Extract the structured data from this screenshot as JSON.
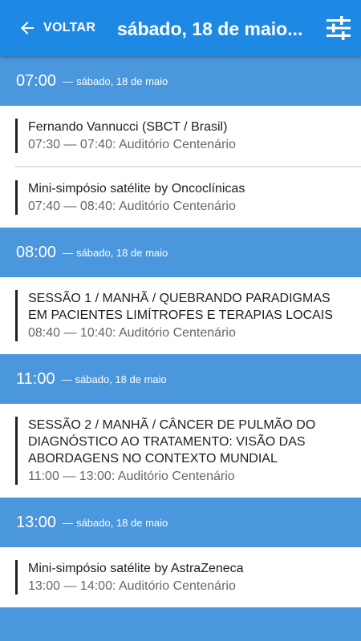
{
  "header": {
    "back_label": "VOLTAR",
    "title": "sábado, 18 de maio..."
  },
  "groups": [
    {
      "time": "07:00",
      "dash": "—",
      "date": "sábado, 18 de maio",
      "sessions": [
        {
          "title": "Fernando Vannucci (SBCT / Brasil)",
          "sub": "07:30 — 07:40: Auditório Centenário"
        },
        {
          "title": "Mini-simpósio satélite by Oncoclínicas",
          "sub": "07:40 — 08:40: Auditório Centenário"
        }
      ]
    },
    {
      "time": "08:00",
      "dash": "—",
      "date": "sábado, 18 de maio",
      "sessions": [
        {
          "title": "SESSÃO 1 / MANHÃ / QUEBRANDO PARADIGMAS EM PACIENTES LIMÍTROFES E TERAPIAS LOCAIS",
          "sub": "08:40 — 10:40: Auditório Centenário"
        }
      ]
    },
    {
      "time": "11:00",
      "dash": "—",
      "date": "sábado, 18 de maio",
      "sessions": [
        {
          "title": "SESSÃO 2 / MANHÃ / CÂNCER DE PULMÃO DO DIAGNÓSTICO AO TRATAMENTO: VISÃO DAS ABORDAGENS NO CONTEXTO MUNDIAL",
          "sub": "11:00 — 13:00: Auditório Centenário"
        }
      ]
    },
    {
      "time": "13:00",
      "dash": "—",
      "date": "sábado, 18 de maio",
      "sessions": [
        {
          "title": "Mini-simpósio satélite by AstraZeneca",
          "sub": "13:00 — 14:00: Auditório Centenário"
        }
      ]
    }
  ],
  "colors": {
    "appbar": "#1e88e5",
    "time_header": "#4a97dd"
  },
  "icons": {
    "back": "arrow-left-icon",
    "filter": "sliders-icon"
  }
}
